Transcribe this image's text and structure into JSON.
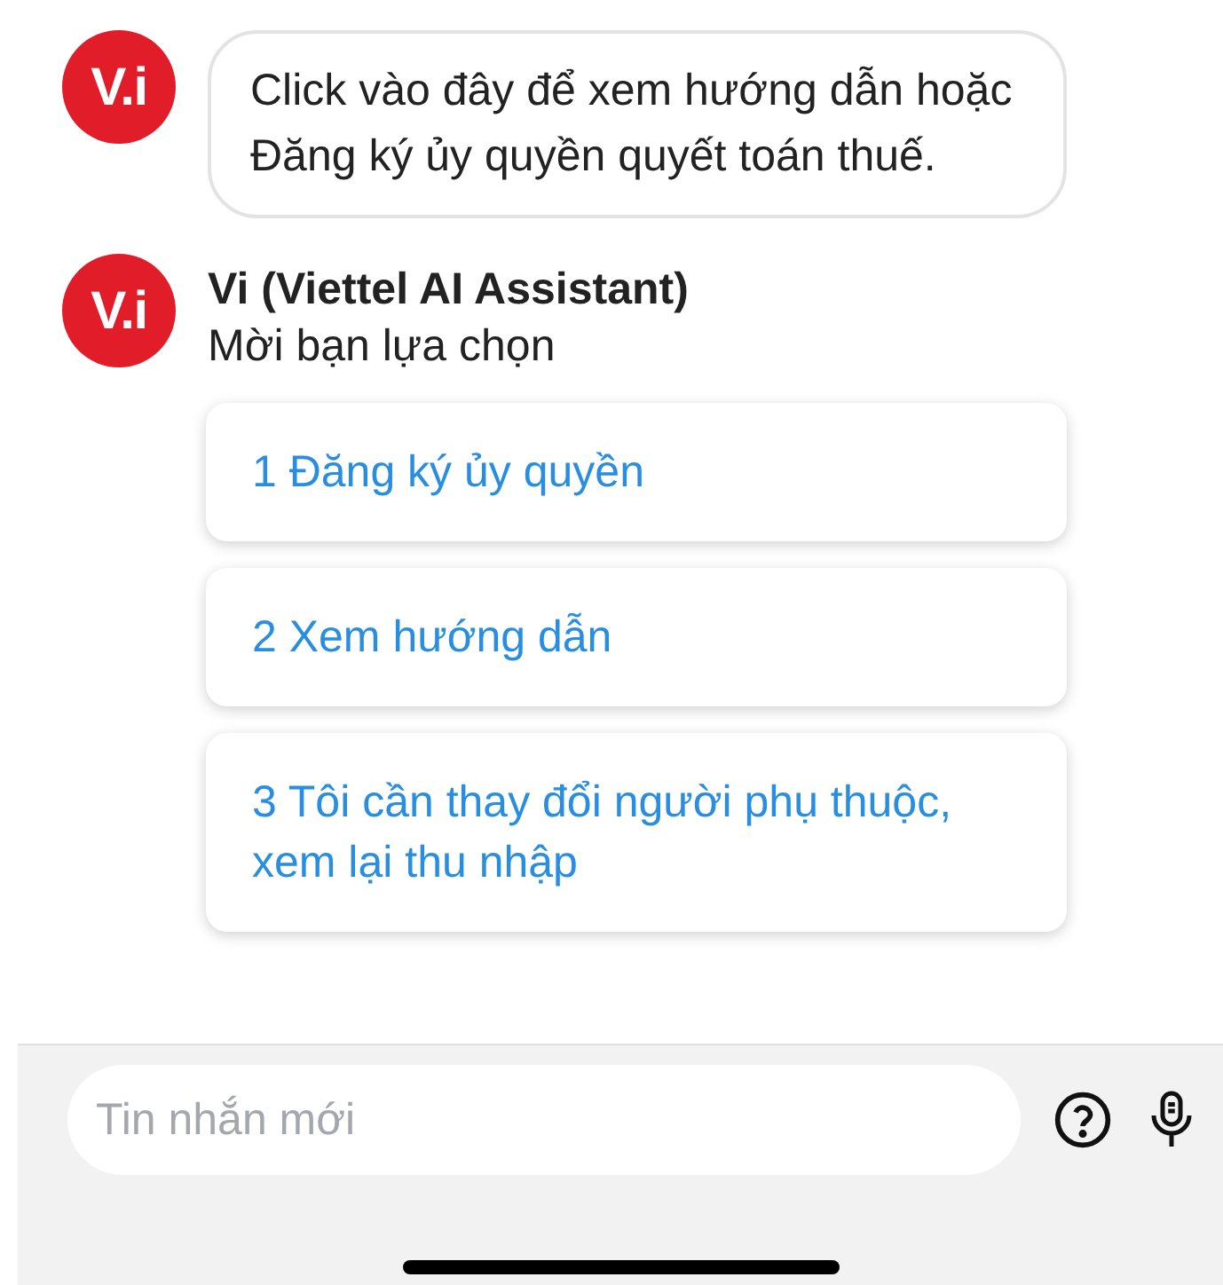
{
  "messages": [
    {
      "avatar": "V.i",
      "text": "Click vào đây để xem hướng dẫn hoặc Đăng ký ủy quyền quyết toán thuế."
    }
  ],
  "bot": {
    "avatar": "V.i",
    "name": "Vi (Viettel AI Assistant)",
    "prompt": "Mời bạn lựa chọn"
  },
  "options": [
    "1 Đăng ký ủy quyền",
    "2 Xem hướng dẫn",
    "3 Tôi cần thay đổi người phụ thuộc, xem lại thu nhập"
  ],
  "composer": {
    "placeholder": "Tin nhắn mới"
  }
}
